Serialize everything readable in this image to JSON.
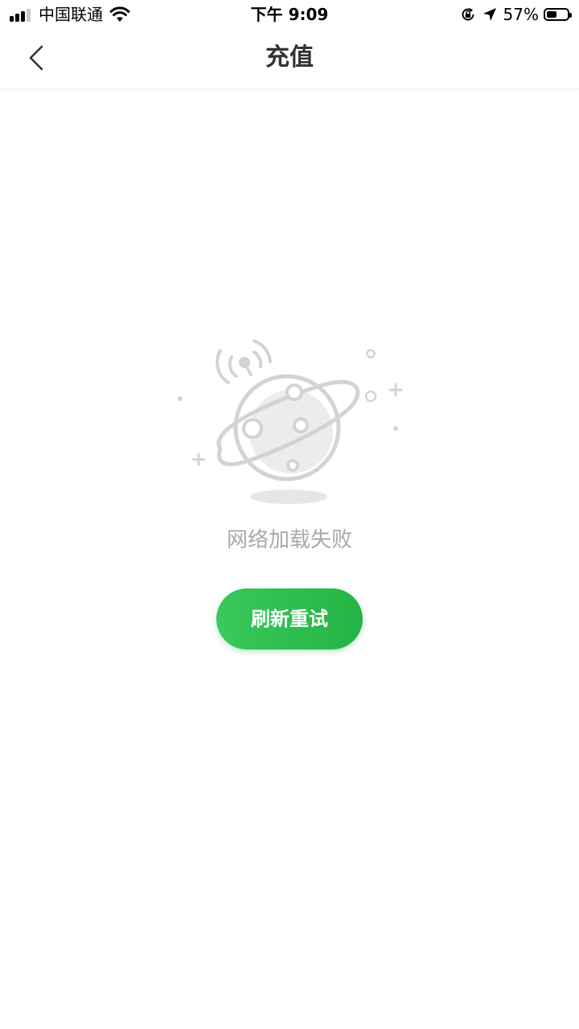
{
  "status_bar": {
    "carrier": "中国联通",
    "time": "下午 9:09",
    "battery_percent": "57%",
    "battery_level": 0.57,
    "icons": [
      "signal-icon",
      "wifi-icon",
      "orientation-lock-icon",
      "location-arrow-icon",
      "battery-icon"
    ]
  },
  "nav": {
    "title": "充值",
    "back_icon": "chevron-left-icon"
  },
  "main": {
    "illustration": "planet-with-antenna-icon",
    "error_message": "网络加载失败",
    "refresh_label": "刷新重试"
  },
  "colors": {
    "accent": "#28b94a",
    "illustration_gray": "#d2d2d2",
    "muted_text": "#a9a9a9",
    "title_text": "#333333"
  }
}
